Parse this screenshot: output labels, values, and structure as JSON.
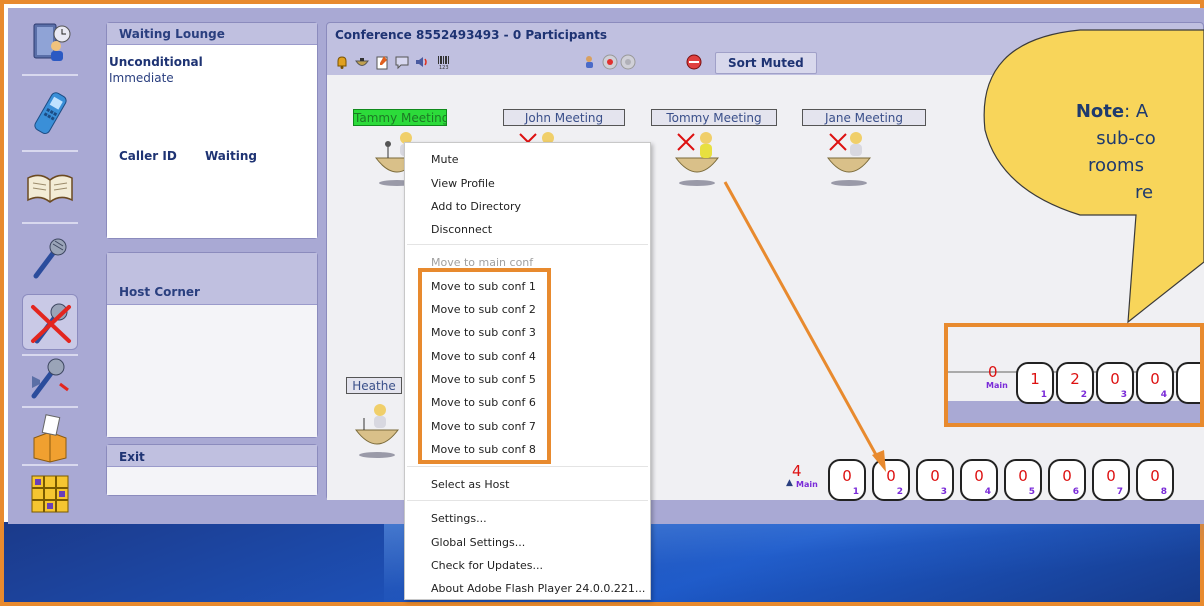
{
  "waiting_lounge": {
    "title": "Waiting Lounge",
    "mode": "Unconditional",
    "mode_sub": "Immediate",
    "col_caller": "Caller ID",
    "col_waiting": "Waiting"
  },
  "host_corner": {
    "title": "Host Corner"
  },
  "exit": {
    "title": "Exit"
  },
  "conference": {
    "title": "Conference 8552493493  - 0 Participants",
    "sort_muted_label": "Sort Muted",
    "rooms": [
      {
        "label": "Tammy Meeting",
        "active": true
      },
      {
        "label": "John Meeting",
        "active": false
      },
      {
        "label": "Tommy Meeting",
        "active": false
      },
      {
        "label": "Jane Meeting",
        "active": false
      },
      {
        "label": "Heathe",
        "active": false
      }
    ],
    "main_counter": {
      "count": "4",
      "label": "Main"
    },
    "sub_counters": [
      {
        "count": "0",
        "index": "1"
      },
      {
        "count": "0",
        "index": "2"
      },
      {
        "count": "0",
        "index": "3"
      },
      {
        "count": "0",
        "index": "4"
      },
      {
        "count": "0",
        "index": "5"
      },
      {
        "count": "0",
        "index": "6"
      },
      {
        "count": "0",
        "index": "7"
      },
      {
        "count": "0",
        "index": "8"
      }
    ]
  },
  "zoom_inset": {
    "main_counter": {
      "count": "0",
      "label": "Main"
    },
    "sub_counters": [
      {
        "count": "1",
        "index": "1"
      },
      {
        "count": "2",
        "index": "2"
      },
      {
        "count": "0",
        "index": "3"
      },
      {
        "count": "0",
        "index": "4"
      }
    ]
  },
  "context_menu": {
    "items": [
      {
        "label": "Mute",
        "disabled": false
      },
      {
        "label": "View Profile",
        "disabled": false
      },
      {
        "label": "Add to Directory",
        "disabled": false
      },
      {
        "label": "Disconnect",
        "disabled": false
      },
      {
        "label": "Move to main conf",
        "disabled": true
      },
      {
        "label": "Move to sub conf 1",
        "disabled": false
      },
      {
        "label": "Move to sub conf 2",
        "disabled": false
      },
      {
        "label": "Move to sub conf 3",
        "disabled": false
      },
      {
        "label": "Move to sub conf 4",
        "disabled": false
      },
      {
        "label": "Move to sub conf 5",
        "disabled": false
      },
      {
        "label": "Move to sub conf 6",
        "disabled": false
      },
      {
        "label": "Move to sub conf 7",
        "disabled": false
      },
      {
        "label": "Move to sub conf 8",
        "disabled": false
      },
      {
        "label": "Select as Host",
        "disabled": false
      },
      {
        "label": "Settings...",
        "disabled": false
      },
      {
        "label": "Global Settings...",
        "disabled": false
      },
      {
        "label": "Check for Updates...",
        "disabled": false
      },
      {
        "label": "About Adobe Flash Player 24.0.0.221...",
        "disabled": false
      }
    ]
  },
  "callout": {
    "note_label": "Note",
    "lines": [
      ": A",
      "sub-co",
      "rooms",
      "re"
    ]
  },
  "colors": {
    "accent_orange": "#e88a2e",
    "active_room": "#2cdb3a",
    "count_red": "#dd1111",
    "index_purple": "#7a2bd8",
    "panel_frame": "#a9a9d4",
    "callout_yellow": "#f8d55a"
  },
  "toolbar_icons": [
    "phonebook-person-icon",
    "cellphone-icon",
    "open-book-icon",
    "microphone-icon",
    "muted-microphone-icon",
    "microphone-speaker-icon",
    "ballot-box-icon",
    "grid-board-icon"
  ]
}
